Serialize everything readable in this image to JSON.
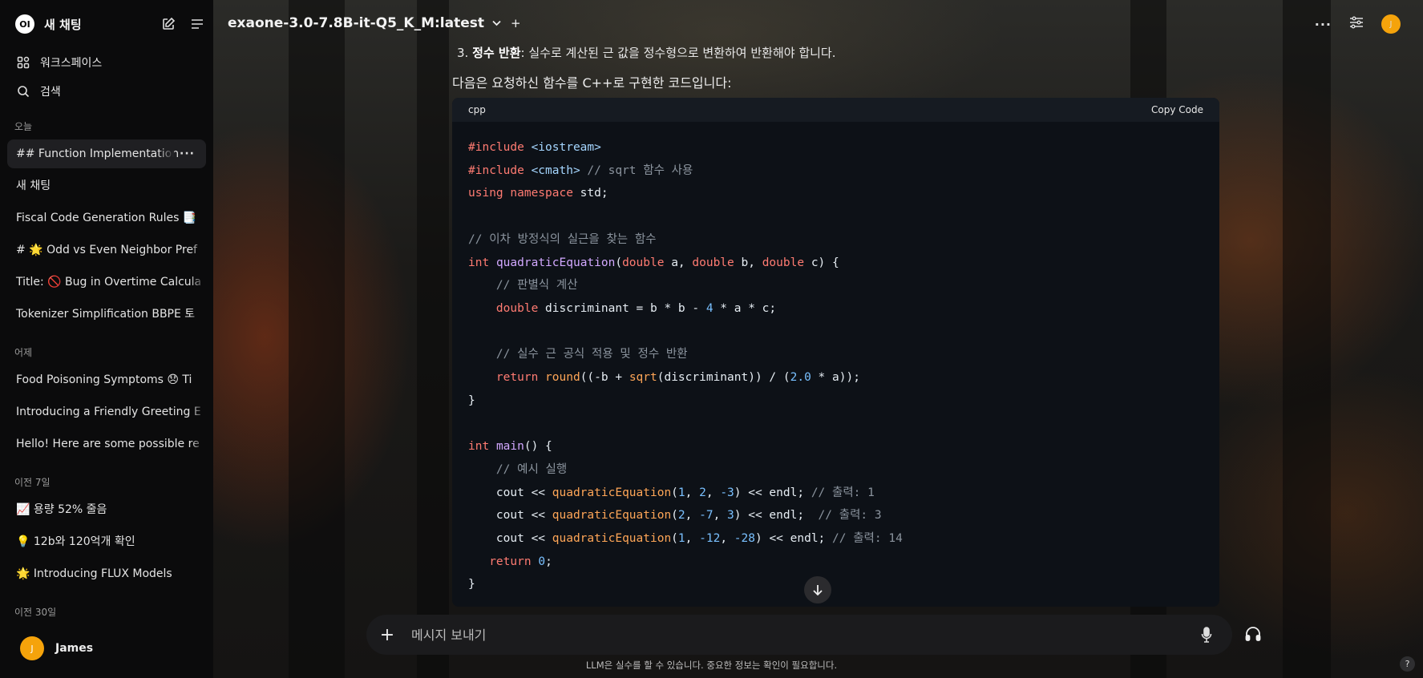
{
  "sidebar": {
    "logo": "OI",
    "brand": "새 채팅",
    "nav": [
      {
        "label": "워크스페이스",
        "icon": "workspace-icon"
      },
      {
        "label": "검색",
        "icon": "search-icon"
      }
    ],
    "sections": [
      {
        "title": "오늘",
        "items": [
          "## Function Implementation",
          "새 채팅",
          "Fiscal Code Generation Rules 📑",
          "# 🌟 Odd vs Even Neighbor Pref",
          "Title: 🚫 Bug in Overtime Calcula",
          "Tokenizer Simplification BBPE 토"
        ]
      },
      {
        "title": "어제",
        "items": [
          "Food Poisoning Symptoms 😞 Ti",
          "Introducing a Friendly Greeting E",
          "Hello! Here are some possible re"
        ]
      },
      {
        "title": "이전 7일",
        "items": [
          "📈 용량 52% 줄음",
          "💡 12b와 120억개 확인",
          "🌟 Introducing FLUX Models"
        ]
      },
      {
        "title": "이전 30일",
        "items": []
      }
    ],
    "active_more": "···",
    "user": {
      "initial": "J",
      "name": "James"
    }
  },
  "header": {
    "model": "exaone-3.0-7.8B-it-Q5_K_M:latest",
    "more": "···",
    "avatar": "J"
  },
  "message": {
    "line3_num": "3.",
    "line3_bold": "정수 반환",
    "line3_text": ": 실수로 계산된 근 값을 정수형으로 변환하여 반환해야 합니다.",
    "intro": "다음은 요청하신 함수를 C++로 구현한 코드입니다:"
  },
  "code": {
    "lang": "cpp",
    "copy_label": "Copy Code"
  },
  "composer": {
    "placeholder": "메시지 보내기"
  },
  "disclaimer": "LLM은 실수를 할 수 있습니다. 중요한 정보는 확인이 필요합니다.",
  "help": "?",
  "colors": {
    "accent": "#f5a30b",
    "sidebar_bg": "#0b0b0c",
    "code_bg": "#0d1117"
  }
}
